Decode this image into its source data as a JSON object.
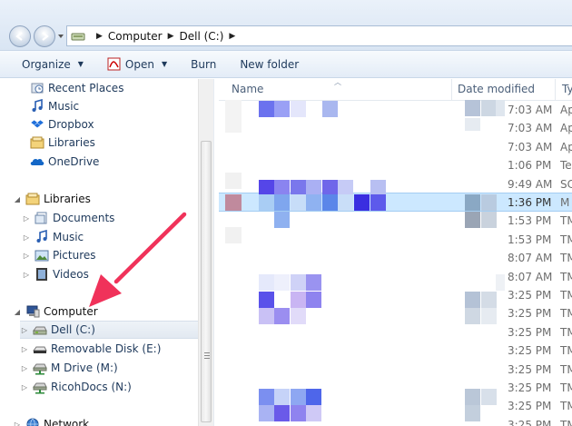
{
  "address": {
    "crumbs": [
      "Computer",
      "Dell (C:)"
    ]
  },
  "toolbar": {
    "organize": "Organize",
    "open": "Open",
    "burn": "Burn",
    "new_folder": "New folder"
  },
  "nav": {
    "favorites": [
      {
        "label": "Recent Places",
        "icon": "recent-places-icon"
      },
      {
        "label": "Music",
        "icon": "music-icon"
      },
      {
        "label": "Dropbox",
        "icon": "dropbox-icon"
      },
      {
        "label": "Libraries",
        "icon": "libraries-icon"
      },
      {
        "label": "OneDrive",
        "icon": "onedrive-icon"
      }
    ],
    "libraries_label": "Libraries",
    "libraries": [
      {
        "label": "Documents",
        "icon": "documents-icon"
      },
      {
        "label": "Music",
        "icon": "music-icon"
      },
      {
        "label": "Pictures",
        "icon": "pictures-icon"
      },
      {
        "label": "Videos",
        "icon": "videos-icon"
      }
    ],
    "computer_label": "Computer",
    "drives": [
      {
        "label": "Dell (C:)",
        "icon": "hard-drive-icon"
      },
      {
        "label": "Removable Disk (E:)",
        "icon": "removable-disk-icon"
      },
      {
        "label": "M Drive (M:)",
        "icon": "network-drive-icon"
      },
      {
        "label": "RicohDocs (N:)",
        "icon": "network-drive-icon"
      }
    ],
    "network_label": "Network"
  },
  "columns": {
    "name": "Name",
    "date_modified": "Date modified",
    "type": "Ty"
  },
  "files": [
    {
      "time": "7:03 AM",
      "type": "Ap"
    },
    {
      "time": "7:03 AM",
      "type": "Ap"
    },
    {
      "time": "7:03 AM",
      "type": "Ap"
    },
    {
      "time": "1:06 PM",
      "type": "Te"
    },
    {
      "time": "9:49 AM",
      "type": "SC"
    },
    {
      "time": "1:36 PM",
      "type": "M"
    },
    {
      "time": "1:53 PM",
      "type": "TM"
    },
    {
      "time": "1:53 PM",
      "type": "TM"
    },
    {
      "time": "8:07 AM",
      "type": "TM"
    },
    {
      "time": "8:07 AM",
      "type": "TM"
    },
    {
      "time": "3:25 PM",
      "type": "TM"
    },
    {
      "time": "3:25 PM",
      "type": "TM"
    },
    {
      "time": "3:25 PM",
      "type": "TM"
    },
    {
      "time": "3:25 PM",
      "type": "TM"
    },
    {
      "time": "3:25 PM",
      "type": "TM"
    },
    {
      "time": "3:25 PM",
      "type": "TM"
    },
    {
      "time": "3:25 PM",
      "type": "TM"
    },
    {
      "time": "3:25 PM",
      "type": "TM"
    }
  ],
  "selected_file_index": 5,
  "colors": {
    "accent_arrow": "#f0325a",
    "selection": "#cce8ff",
    "nav_text": "#1e395b"
  }
}
